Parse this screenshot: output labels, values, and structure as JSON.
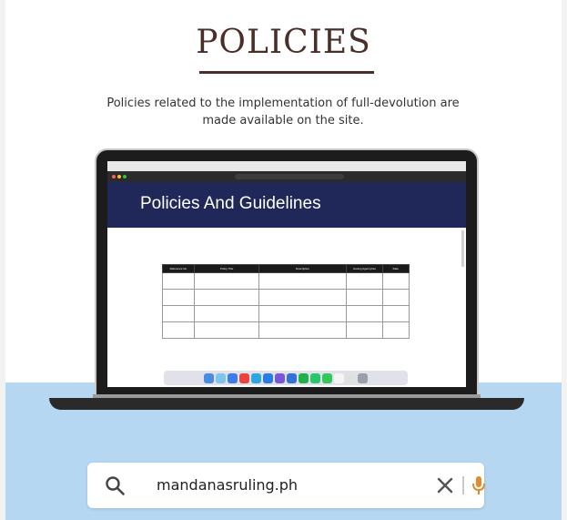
{
  "header": {
    "title": "POLICIES",
    "subtitle": "Policies related to the implementation of full-devolution are made available on the site."
  },
  "screen": {
    "hero_title": "Policies And Guidelines",
    "table_headers": [
      "Reference No.",
      "Policy Title",
      "Description",
      "Issuing Agency/ies",
      "Date"
    ]
  },
  "search": {
    "query": "mandanasruling.ph"
  },
  "colors": {
    "title": "#4a2e2a",
    "bottom_band": "#b6d7f2",
    "hero": "#1f2858",
    "mic": "#e08a2b"
  },
  "icons": [
    "search-icon",
    "clear-icon",
    "microphone-icon"
  ]
}
